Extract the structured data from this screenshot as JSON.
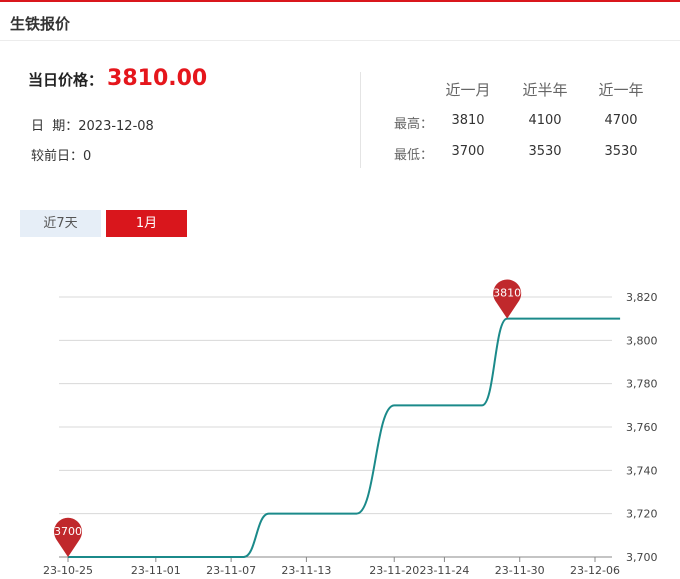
{
  "header": {
    "title": "生铁报价"
  },
  "summary": {
    "price_label": "当日价格：",
    "price_value": "3810.00",
    "date_label": "日  期：",
    "date_value": "2023-12-08",
    "prev_label": "较前日：",
    "prev_value": "0"
  },
  "stats": {
    "columns": [
      "近一月",
      "近半年",
      "近一年"
    ],
    "high_label": "最高：",
    "low_label": "最低：",
    "high": [
      "3810",
      "4100",
      "4700"
    ],
    "low": [
      "3700",
      "3530",
      "3530"
    ]
  },
  "tabs": [
    {
      "label": "近7天",
      "active": false
    },
    {
      "label": "1月",
      "active": true
    }
  ],
  "colors": {
    "accent": "#d9161c",
    "line": "#1b8a8a",
    "marker": "#c0282c"
  },
  "chart_data": {
    "type": "line",
    "x_tick_labels": [
      "23-10-25",
      "23-11-01",
      "23-11-07",
      "23-11-13",
      "23-11-20",
      "23-11-24",
      "23-11-30",
      "23-12-06"
    ],
    "x": [
      "2023-10-25",
      "2023-11-08",
      "2023-11-10",
      "2023-11-14",
      "2023-11-17",
      "2023-11-20",
      "2023-11-21",
      "2023-11-23",
      "2023-11-27",
      "2023-11-29",
      "2023-11-30",
      "2023-12-08"
    ],
    "series": [
      {
        "values": [
          3700,
          3700,
          3720,
          3720,
          3720,
          3770,
          3770,
          3770,
          3770,
          3810,
          3810,
          3810
        ]
      }
    ],
    "y_ticks": [
      3700,
      3720,
      3740,
      3760,
      3780,
      3800,
      3820
    ],
    "ylim": [
      3700,
      3820
    ],
    "y_axis_position": "right",
    "grid": true,
    "markers": [
      {
        "label": "3700",
        "x": "2023-10-25",
        "value": 3700
      },
      {
        "label": "3810",
        "x": "2023-11-29",
        "value": 3810
      }
    ]
  }
}
